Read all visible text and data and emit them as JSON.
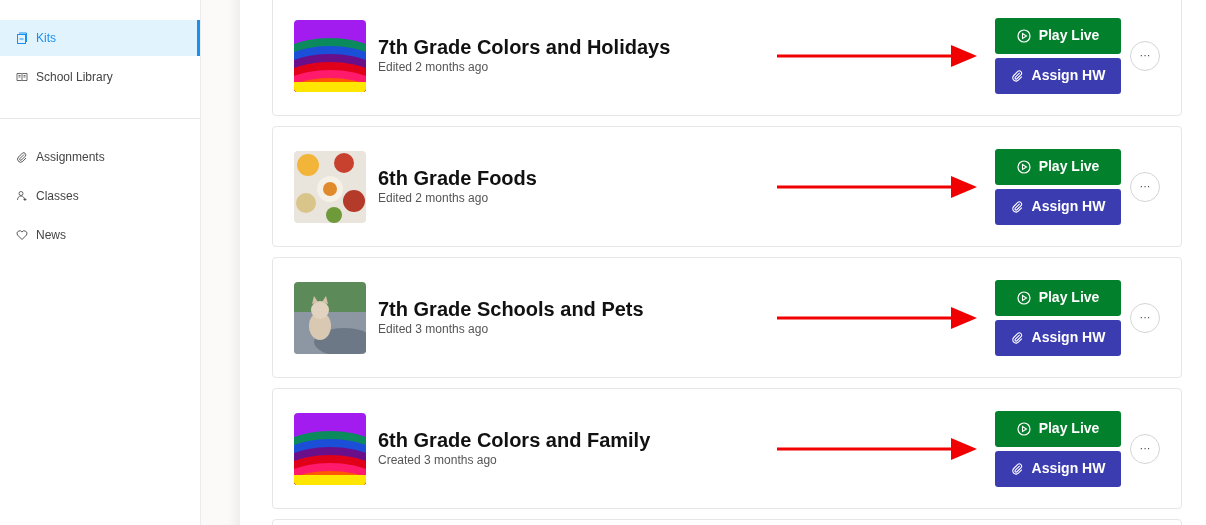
{
  "sidebar": {
    "items": [
      {
        "label": "Kits",
        "selected": true
      },
      {
        "label": "School Library",
        "selected": false
      },
      {
        "label": "Assignments",
        "selected": false
      },
      {
        "label": "Classes",
        "selected": false
      },
      {
        "label": "News",
        "selected": false
      }
    ]
  },
  "kits": [
    {
      "title": "7th Grade Colors and Holidays",
      "subtitle": "Edited 2 months ago",
      "play_button": "Play Live",
      "assign_button": "Assign HW",
      "more_button": "···",
      "arrow": true
    },
    {
      "title": "6th Grade Foods",
      "subtitle": "Edited 2 months ago",
      "play_button": "Play Live",
      "assign_button": "Assign HW",
      "more_button": "···",
      "arrow": true
    },
    {
      "title": "7th Grade Schools and Pets",
      "subtitle": "Edited 3 months ago",
      "play_button": "Play Live",
      "assign_button": "Assign HW",
      "more_button": "···",
      "arrow": true
    },
    {
      "title": "6th Grade Colors and Family",
      "subtitle": "Created 3 months ago",
      "play_button": "Play Live",
      "assign_button": "Assign HW",
      "more_button": "···",
      "arrow": true
    }
  ]
}
